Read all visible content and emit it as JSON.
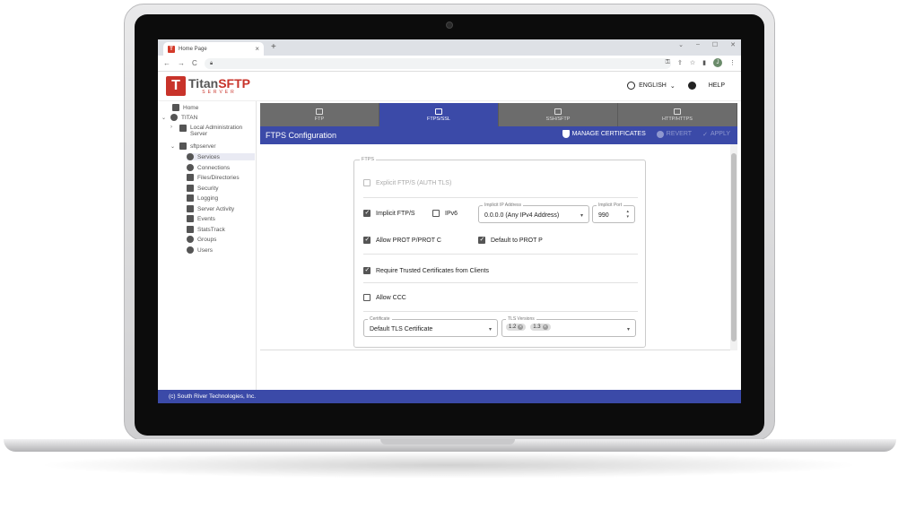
{
  "browser": {
    "tab_title": "Home Page",
    "new_tab": "+",
    "close": "×",
    "win_controls": [
      "⌄",
      "–",
      "☐",
      "✕"
    ],
    "nav": [
      "←",
      "→",
      "C"
    ],
    "profile_initial": "J"
  },
  "header": {
    "logo_prefix": "Titan",
    "logo_accent": "SFTP",
    "logo_sub": "SERVER",
    "language": "ENGLISH",
    "help": "HELP"
  },
  "sidebar": {
    "items": [
      {
        "label": "Home",
        "icon": "home-icon"
      },
      {
        "label": "TITAN",
        "icon": "globe-icon"
      },
      {
        "label": "Local Administration",
        "label2": "Server",
        "icon": "server-icon"
      },
      {
        "label": "sftpserver",
        "icon": "server-icon"
      },
      {
        "label": "Services",
        "icon": "refresh-icon"
      },
      {
        "label": "Connections",
        "icon": "globe-icon"
      },
      {
        "label": "Files/Directories",
        "icon": "folder-icon"
      },
      {
        "label": "Security",
        "icon": "lock-icon"
      },
      {
        "label": "Logging",
        "icon": "magnifier-icon"
      },
      {
        "label": "Server Activity",
        "icon": "list-icon"
      },
      {
        "label": "Events",
        "icon": "calendar-icon"
      },
      {
        "label": "StatsTrack",
        "icon": "checkbox-icon"
      },
      {
        "label": "Groups",
        "icon": "group-icon"
      },
      {
        "label": "Users",
        "icon": "user-icon"
      }
    ]
  },
  "service_tabs": [
    {
      "label": "FTP",
      "icon": "folder-icon"
    },
    {
      "label": "FTPS/SSL",
      "icon": "lock-icon",
      "active": true
    },
    {
      "label": "SSH/SFTP",
      "icon": "key-icon"
    },
    {
      "label": "HTTP/HTTPS",
      "icon": "globe-lock-icon"
    }
  ],
  "config": {
    "title": "FTPS Configuration",
    "manage_certificates": "MANAGE CERTIFICATES",
    "revert": "REVERT",
    "apply": "APPLY"
  },
  "ftps": {
    "group_label": "FTPS",
    "explicit": {
      "label": "Explicit FTP/S (AUTH TLS)",
      "checked": false,
      "disabled": true
    },
    "implicit": {
      "label": "Implicit FTP/S",
      "checked": true
    },
    "ipv6": {
      "label": "IPv6",
      "checked": false
    },
    "implicit_ip": {
      "label": "Implicit IP Address",
      "value": "0.0.0.0 (Any IPv4 Address)"
    },
    "implicit_port": {
      "label": "Implicit Port",
      "value": "990"
    },
    "allow_prot": {
      "label": "Allow PROT P/PROT C",
      "checked": true
    },
    "default_prot": {
      "label": "Default to PROT P",
      "checked": true
    },
    "require_trusted": {
      "label": "Require Trusted Certificates from Clients",
      "checked": true
    },
    "allow_ccc": {
      "label": "Allow CCC",
      "checked": false
    },
    "certificate": {
      "label": "Certificate",
      "value": "Default TLS Certificate"
    },
    "tls_versions": {
      "label": "TLS Versions",
      "chips": [
        "1.2",
        "1.3"
      ]
    }
  },
  "footer": {
    "text": "(c) South River Technologies, Inc."
  },
  "colors": {
    "brand_blue": "#3b4aa8",
    "brand_red": "#c8332a",
    "tab_gray": "#6c6c6c"
  }
}
